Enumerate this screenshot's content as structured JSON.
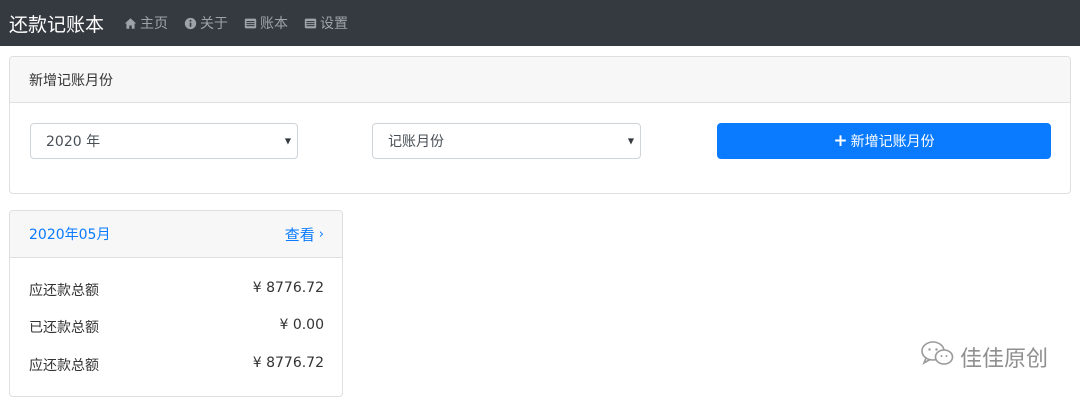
{
  "navbar": {
    "brand": "还款记账本",
    "items": [
      {
        "label": "主页",
        "icon": "home-icon"
      },
      {
        "label": "关于",
        "icon": "info-icon"
      },
      {
        "label": "账本",
        "icon": "list-icon"
      },
      {
        "label": "设置",
        "icon": "list-icon"
      }
    ]
  },
  "add_panel": {
    "header": "新增记账月份",
    "year_select": {
      "value": "2020 年"
    },
    "month_select": {
      "value": "记账月份"
    },
    "add_button": {
      "label": "新增记账月份",
      "icon": "plus-icon"
    }
  },
  "month_card": {
    "title": "2020年05月",
    "view_link": "查看",
    "rows": [
      {
        "label": "应还款总额",
        "amount": "¥ 8776.72"
      },
      {
        "label": "已还款总额",
        "amount": "¥ 0.00"
      },
      {
        "label": "应还款总额",
        "amount": "¥ 8776.72"
      }
    ]
  },
  "watermark": {
    "text": "佳佳原创",
    "icon": "wechat-icon"
  },
  "colors": {
    "navbar_bg": "#343a40",
    "primary": "#0a7bff",
    "header_bg": "#f7f7f7",
    "border": "#dfdfdf"
  }
}
